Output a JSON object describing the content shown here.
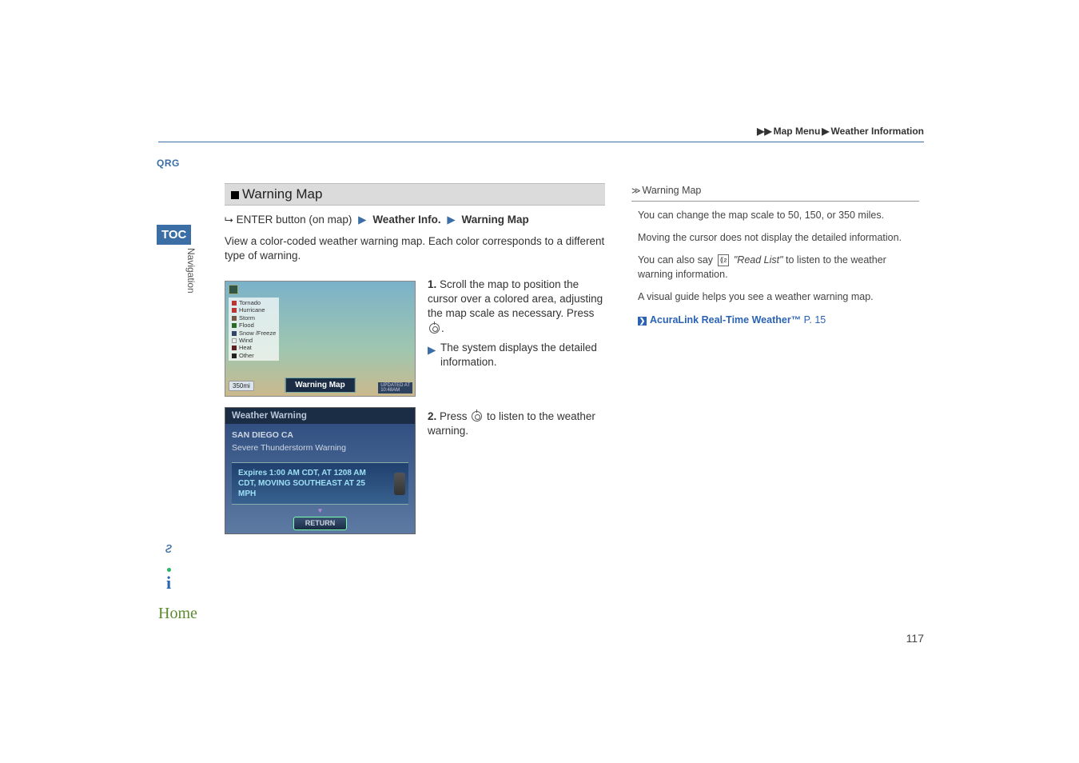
{
  "breadcrumb": {
    "arrow": "▶▶",
    "level1": "Map Menu",
    "sep": "▶",
    "level2": "Weather Information"
  },
  "left": {
    "qrg": "QRG",
    "toc": "TOC",
    "nav": "Navigation"
  },
  "section": {
    "heading": "Warning Map",
    "path_prefix": "ENTER button (on map)",
    "path_item1": "Weather Info.",
    "path_item2": "Warning Map",
    "body": "View a color-coded weather warning map. Each color corresponds to a different type of warning."
  },
  "map": {
    "legend": [
      {
        "color": "#b33",
        "label": "Tornado"
      },
      {
        "color": "#b33",
        "label": "Hurricane"
      },
      {
        "color": "#754",
        "label": "Storm"
      },
      {
        "color": "#2a6b2a",
        "label": "Flood"
      },
      {
        "color": "#346",
        "label": "Snow /Freeze"
      },
      {
        "color": "#ccc",
        "label": "Wind"
      },
      {
        "color": "#5a2020",
        "label": "Heat"
      },
      {
        "color": "#222",
        "label": "Other"
      }
    ],
    "scale": "350mi",
    "title": "Warning Map",
    "updated_label": "UPDATED AT",
    "updated_time": "10:48AM"
  },
  "steps": {
    "s1_num": "1.",
    "s1_text": "Scroll the map to position the cursor over a colored area, adjusting the map scale as necessary. Press ",
    "s1_suffix": ".",
    "s1_sub": "The system displays the detailed information.",
    "s2_num": "2.",
    "s2_text_a": "Press ",
    "s2_text_b": " to listen to the weather warning."
  },
  "warning_panel": {
    "header": "Weather Warning",
    "location": "SAN DIEGO CA",
    "severity": "Severe Thunderstorm Warning",
    "detail": "Expires 1:00 AM CDT, AT 1208 AM CDT, MOVING SOUTHEAST AT 25 MPH",
    "return": "RETURN"
  },
  "sidebar": {
    "title": "Warning Map",
    "p1": "You can change the map scale to 50, 150, or 350 miles.",
    "p2": "Moving the cursor does not display the detailed information.",
    "p3a": "You can also say ",
    "p3q": "\"Read List\"",
    "p3b": " to listen to the weather warning information.",
    "p4": "A visual guide helps you see a weather warning map.",
    "link_text": "AcuraLink Real-Time Weather™",
    "link_pg": " P. 15"
  },
  "bottom": {
    "home": "Home"
  },
  "page_number": "117"
}
